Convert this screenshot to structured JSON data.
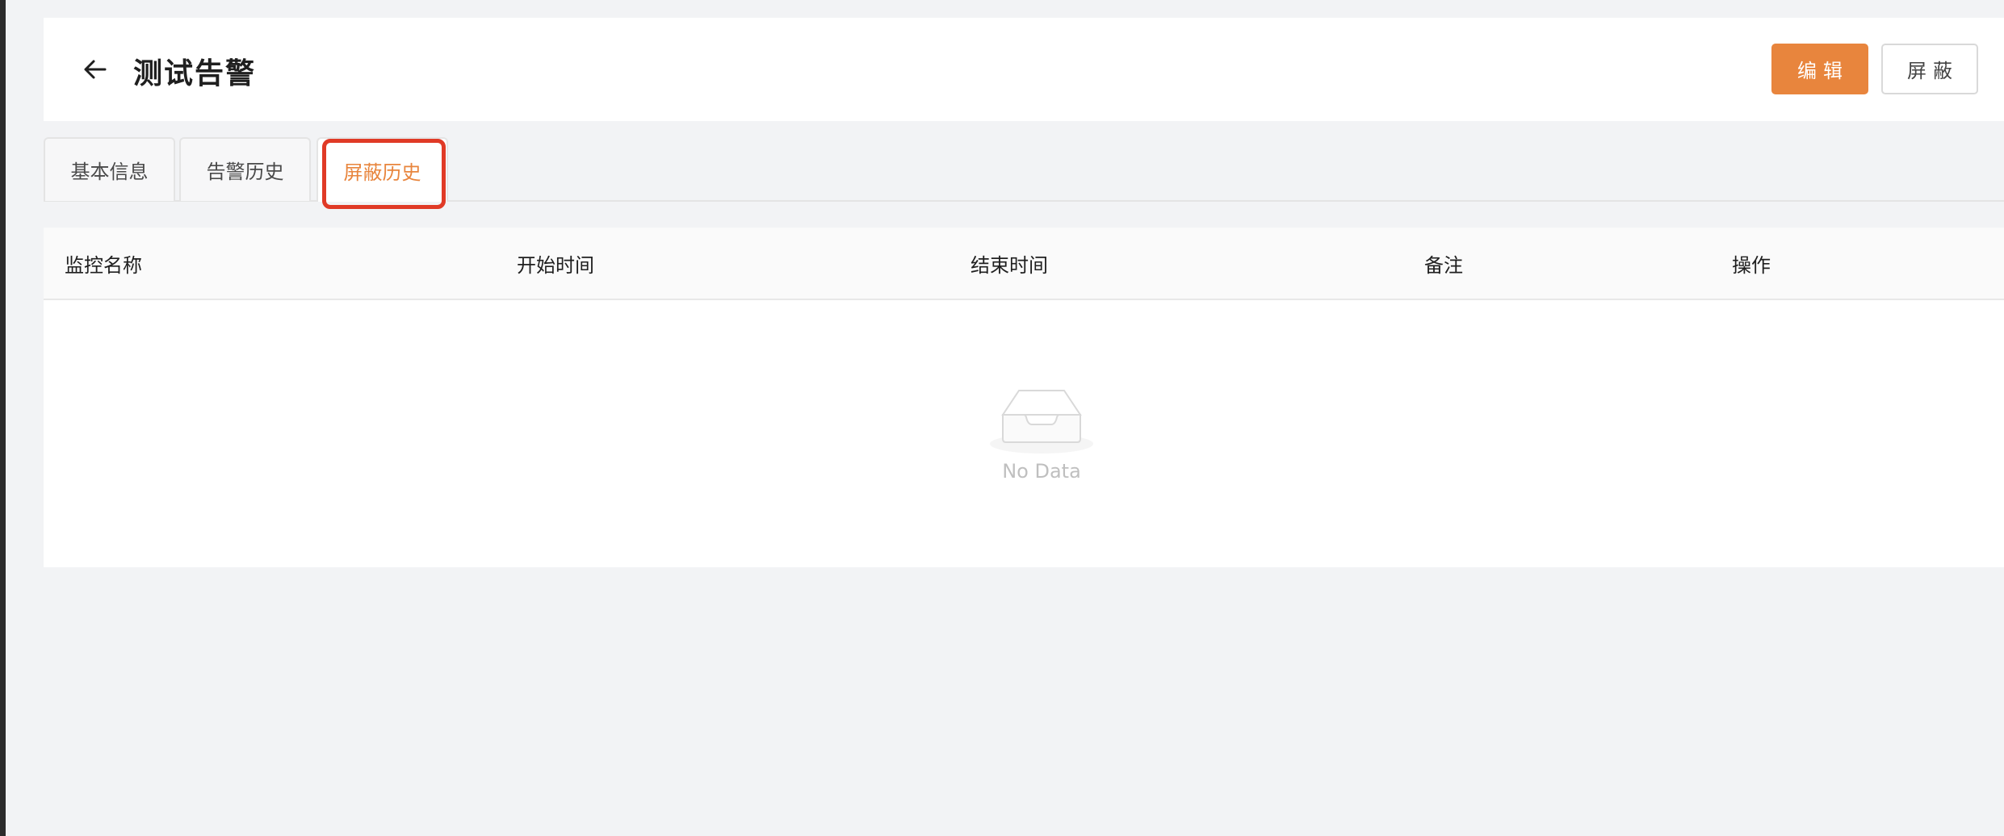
{
  "header": {
    "title": "测试告警",
    "edit_label": "编辑",
    "mask_label": "屏蔽"
  },
  "tabs": [
    {
      "label": "基本信息",
      "active": false
    },
    {
      "label": "告警历史",
      "active": false
    },
    {
      "label": "屏蔽历史",
      "active": true
    }
  ],
  "table": {
    "columns": [
      "监控名称",
      "开始时间",
      "结束时间",
      "备注",
      "操作"
    ],
    "rows": [],
    "empty_text": "No Data"
  },
  "colors": {
    "accent": "#e8853d",
    "highlight": "#e03a26",
    "background": "#f2f3f5"
  },
  "icons": {
    "back": "arrow-left-icon",
    "empty": "empty-inbox-icon"
  }
}
